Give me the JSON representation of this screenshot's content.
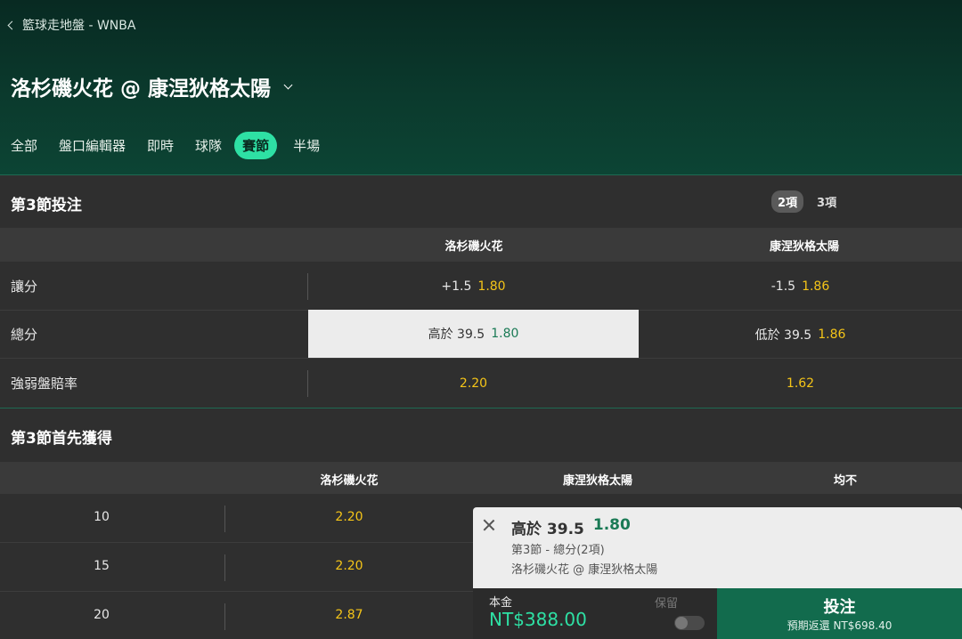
{
  "header": {
    "breadcrumb": "籃球走地盤 - WNBA",
    "match_title": "洛杉磯火花 @ 康涅狄格太陽",
    "tabs": [
      "全部",
      "盤口編輯器",
      "即時",
      "球隊",
      "賽節",
      "半場"
    ],
    "active_tab": "賽節"
  },
  "section1": {
    "title": "第3節投注",
    "count_options": [
      "2項",
      "3項"
    ],
    "active_count": "2項",
    "columns": [
      "洛杉磯火花",
      "康涅狄格太陽"
    ],
    "rows": [
      {
        "label": "讓分",
        "home": {
          "line": "+1.5",
          "odds": "1.80"
        },
        "away": {
          "line": "-1.5",
          "odds": "1.86"
        }
      },
      {
        "label": "總分",
        "home": {
          "line": "高於 39.5",
          "odds": "1.80",
          "selected": true
        },
        "away": {
          "line": "低於 39.5",
          "odds": "1.86"
        }
      },
      {
        "label": "強弱盤賠率",
        "home": {
          "line": "",
          "odds": "2.20"
        },
        "away": {
          "line": "",
          "odds": "1.62"
        }
      }
    ]
  },
  "section2": {
    "title": "第3節首先獲得",
    "columns": [
      "洛杉磯火花",
      "康涅狄格太陽",
      "均不"
    ],
    "rows": [
      {
        "points": "10",
        "home": "2.20"
      },
      {
        "points": "15",
        "home": "2.20"
      },
      {
        "points": "20",
        "home": "2.87"
      }
    ]
  },
  "betslip": {
    "selection": "高於 39.5",
    "odds": "1.80",
    "market": "第3節 - 總分(2項)",
    "event": "洛杉磯火花 @ 康涅狄格太陽",
    "stake_label": "本金",
    "stake_value": "NT$388.00",
    "keep_label": "保留",
    "keep_enabled": false,
    "bet_label": "投注",
    "expected_return": "預期返還 NT$698.40"
  },
  "colors": {
    "accent": "#2ee0a4",
    "odds": "#f5c518",
    "header_bg": "#0b3a2d",
    "bet_button": "#126b4d"
  }
}
